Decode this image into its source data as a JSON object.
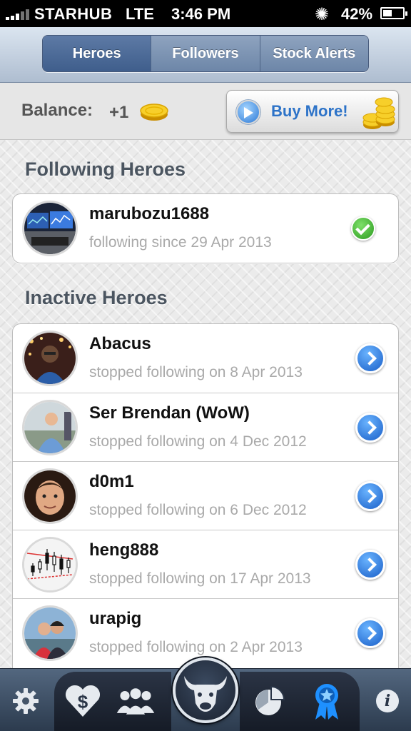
{
  "status_bar": {
    "carrier": "STARHUB",
    "network": "LTE",
    "time": "3:46 PM",
    "battery": "42%"
  },
  "tabs": [
    "Heroes",
    "Followers",
    "Stock Alerts"
  ],
  "balance": {
    "label": "Balance:",
    "value": "+1",
    "buy_label": "Buy More!"
  },
  "following": {
    "title": "Following Heroes",
    "items": [
      {
        "name": "marubozu1688",
        "subtitle": "following since 29 Apr 2013"
      }
    ]
  },
  "inactive": {
    "title": "Inactive Heroes",
    "items": [
      {
        "name": "Abacus",
        "subtitle": "stopped following on 8 Apr 2013"
      },
      {
        "name": "Ser Brendan (WoW)",
        "subtitle": "stopped following on 4 Dec 2012"
      },
      {
        "name": "d0m1",
        "subtitle": "stopped following on 6 Dec 2012"
      },
      {
        "name": "heng888",
        "subtitle": "stopped following on 17 Apr 2013"
      },
      {
        "name": "urapig",
        "subtitle": "stopped following on 2 Apr 2013"
      }
    ]
  },
  "tabbar": {
    "icons": [
      "gear-icon",
      "heart-dollar-icon",
      "people-icon",
      "bull-logo-icon",
      "pie-chart-icon",
      "ribbon-award-icon",
      "info-icon"
    ],
    "info_glyph": "i"
  },
  "colors": {
    "accent_blue": "#2d73c8",
    "selected_tab": "#1e90ff",
    "check_green": "#2b9a1f"
  }
}
